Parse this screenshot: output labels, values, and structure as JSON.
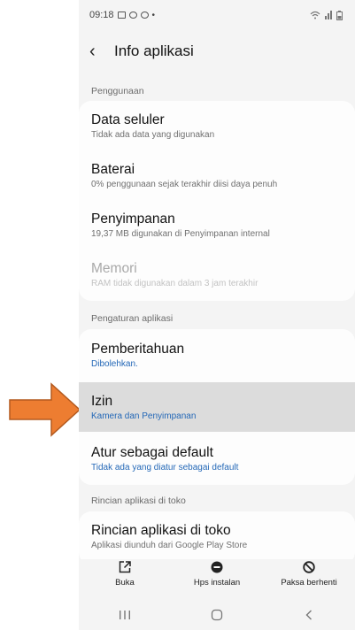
{
  "status_bar": {
    "time": "09:18"
  },
  "header": {
    "title": "Info aplikasi"
  },
  "sections": {
    "usage": "Penggunaan",
    "app_settings": "Pengaturan aplikasi",
    "store_details": "Rincian aplikasi di toko"
  },
  "items": {
    "mobile_data": {
      "title": "Data seluler",
      "subtitle": "Tidak ada data yang digunakan"
    },
    "battery": {
      "title": "Baterai",
      "subtitle": "0% penggunaan sejak terakhir diisi daya penuh"
    },
    "storage": {
      "title": "Penyimpanan",
      "subtitle": "19,37 MB digunakan di Penyimpanan internal"
    },
    "memory": {
      "title": "Memori",
      "subtitle": "RAM tidak digunakan dalam 3 jam terakhir"
    },
    "notifications": {
      "title": "Pemberitahuan",
      "subtitle": "Dibolehkan."
    },
    "permissions": {
      "title": "Izin",
      "subtitle": "Kamera dan Penyimpanan"
    },
    "set_default": {
      "title": "Atur sebagai default",
      "subtitle": "Tidak ada yang diatur sebagai default"
    },
    "store": {
      "title": "Rincian aplikasi di toko",
      "subtitle": "Aplikasi diunduh dari Google Play Store"
    }
  },
  "actions": {
    "open": "Buka",
    "uninstall": "Hps instalan",
    "force_stop": "Paksa berhenti"
  },
  "colors": {
    "accent": "#2468b7",
    "highlight": "#dcdcdc",
    "arrow": "#ed7d31"
  }
}
